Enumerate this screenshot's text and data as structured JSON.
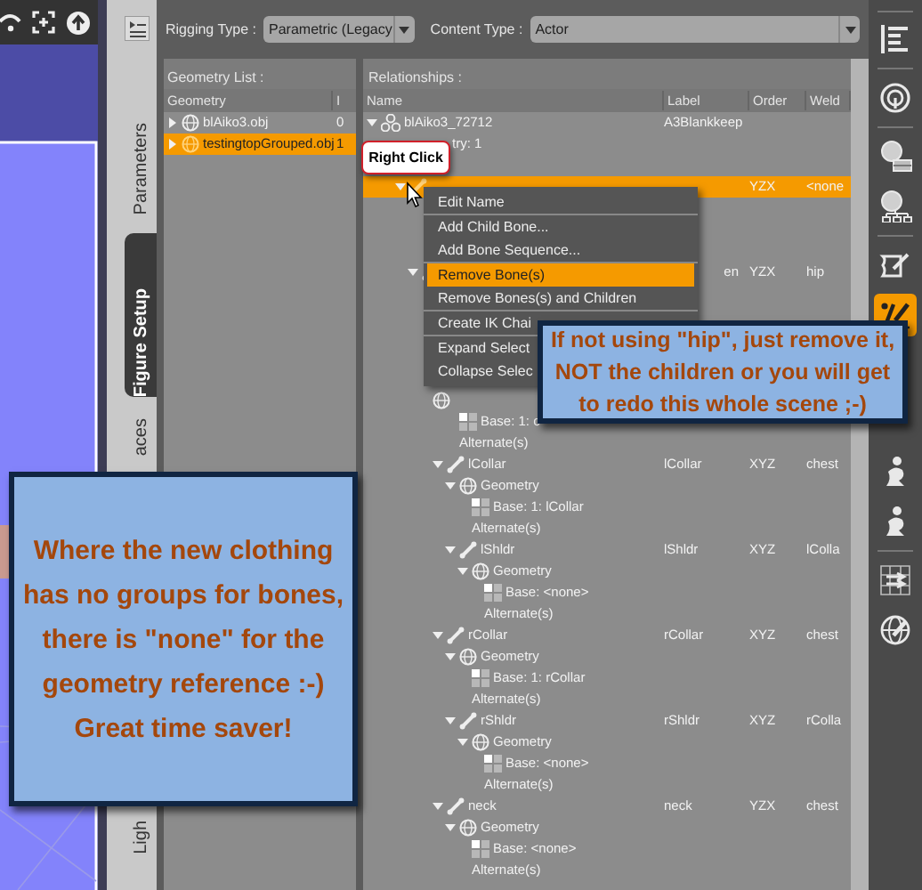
{
  "side_tabs": [
    {
      "label": "Parameters",
      "selected": false
    },
    {
      "label": "Figure Setup",
      "selected": true
    },
    {
      "label": "aces",
      "selected": false
    },
    {
      "label": "Ligh",
      "selected": false
    }
  ],
  "rigging_type": {
    "label": "Rigging Type :",
    "value": "Parametric (Legacy"
  },
  "content_type": {
    "label": "Content Type :",
    "value": "Actor"
  },
  "geometry_list": {
    "title": "Geometry List :",
    "columns": [
      "Geometry",
      "I"
    ],
    "rows": [
      {
        "name": "blAiko3.obj",
        "column_2": "0",
        "selected": false,
        "expanded": false
      },
      {
        "name": "testingtopGrouped.obj",
        "column_2": "1",
        "selected": true,
        "expanded": false
      }
    ]
  },
  "relationships": {
    "title": "Relationships :",
    "columns": [
      "Name",
      "Label",
      "Order",
      "Weld"
    ],
    "tree": [
      {
        "kind": "figure",
        "name": "blAiko3_72712",
        "label": "A3Blankkeep",
        "expanded": true,
        "selected": false,
        "children": [
          {
            "kind": "geometry_count",
            "text": "try: 1"
          },
          {
            "kind": "bone",
            "order": "YZX",
            "weld": "<none",
            "expanded": true,
            "selected": true,
            "children": [
              {
                "kind": "bone",
                "label": "en",
                "order": "YZX",
                "weld": "hip",
                "expanded": true,
                "selected": false,
                "children": [
                  {
                    "children": [
                      {
                        "kind": "geometry",
                        "children": [
                          {
                            "kind": "base",
                            "text": "Base: 1: c"
                          },
                          {
                            "kind": "alternate",
                            "text": "Alternate(s)"
                          }
                        ]
                      },
                      {
                        "kind": "bone",
                        "name": "lCollar",
                        "label": "lCollar",
                        "order": "XYZ",
                        "weld": "chest",
                        "expanded": true,
                        "selected": false,
                        "children": [
                          {
                            "kind": "geometry",
                            "text": "Geometry",
                            "expanded": true,
                            "children": [
                              {
                                "kind": "base",
                                "text": "Base: 1: lCollar"
                              },
                              {
                                "kind": "alternate",
                                "text": "Alternate(s)"
                              }
                            ]
                          },
                          {
                            "kind": "bone",
                            "name": "lShldr",
                            "label": "lShldr",
                            "order": "XYZ",
                            "weld": "lColla",
                            "expanded": true,
                            "selected": false,
                            "children": [
                              {
                                "kind": "geometry",
                                "text": "Geometry",
                                "expanded": true,
                                "children": [
                                  {
                                    "kind": "base",
                                    "text": "Base: <none>"
                                  },
                                  {
                                    "kind": "alternate",
                                    "text": "Alternate(s)"
                                  }
                                ]
                              }
                            ]
                          }
                        ]
                      },
                      {
                        "kind": "bone",
                        "name": "rCollar",
                        "label": "rCollar",
                        "order": "XYZ",
                        "weld": "chest",
                        "expanded": true,
                        "selected": false,
                        "children": [
                          {
                            "kind": "geometry",
                            "text": "Geometry",
                            "expanded": true,
                            "children": [
                              {
                                "kind": "base",
                                "text": "Base: 1: rCollar"
                              },
                              {
                                "kind": "alternate",
                                "text": "Alternate(s)"
                              }
                            ]
                          },
                          {
                            "kind": "bone",
                            "name": "rShldr",
                            "label": "rShldr",
                            "order": "XYZ",
                            "weld": "rColla",
                            "expanded": true,
                            "selected": false,
                            "children": [
                              {
                                "kind": "geometry",
                                "text": "Geometry",
                                "expanded": true,
                                "children": [
                                  {
                                    "kind": "base",
                                    "text": "Base: <none>"
                                  },
                                  {
                                    "kind": "alternate",
                                    "text": "Alternate(s)"
                                  }
                                ]
                              }
                            ]
                          }
                        ]
                      },
                      {
                        "kind": "bone",
                        "name": "neck",
                        "label": "neck",
                        "order": "YZX",
                        "weld": "chest",
                        "expanded": true,
                        "selected": false,
                        "children": [
                          {
                            "kind": "geometry",
                            "text": "Geometry",
                            "expanded": true,
                            "children": [
                              {
                                "kind": "base",
                                "text": "Base: <none>"
                              },
                              {
                                "kind": "alternate",
                                "text": "Alternate(s)"
                              }
                            ]
                          }
                        ]
                      }
                    ]
                  }
                ]
              }
            ]
          }
        ]
      }
    ]
  },
  "context_menu": {
    "sections": [
      [
        {
          "label": "Edit Name",
          "selected": false
        }
      ],
      [
        {
          "label": "Add Child Bone...",
          "selected": false
        },
        {
          "label": "Add Bone Sequence...",
          "selected": false
        }
      ],
      [
        {
          "label": "Remove Bone(s)",
          "selected": true
        },
        {
          "label": "Remove Bones(s) and Children",
          "selected": false
        }
      ],
      [
        {
          "label": "Create IK Chai",
          "selected": false
        }
      ],
      [
        {
          "label": "Expand Select",
          "selected": false
        },
        {
          "label": "Collapse Selec",
          "selected": false
        }
      ]
    ]
  },
  "right_click_bubble": {
    "text": "Right Click"
  },
  "notes": [
    {
      "text": "If not using \"hip\", just remove it, NOT the children or you will get to redo this whole scene ;-)"
    },
    {
      "text": "Where the new clothing has no groups for bones, there is \"none\" for the geometry reference :-) Great time saver!"
    }
  ],
  "sidebar_icons": [
    {
      "kind": "panes",
      "selected": false
    },
    {
      "kind": "dial",
      "selected": false
    },
    {
      "kind": "figure",
      "selected": false
    },
    {
      "kind": "hierarchy",
      "selected": false
    },
    {
      "kind": "script",
      "selected": false
    },
    {
      "kind": "bone_edit",
      "selected": true
    },
    {
      "kind": "pose",
      "selected": false
    },
    {
      "kind": "pose",
      "selected": false
    },
    {
      "kind": "grid",
      "selected": false
    },
    {
      "kind": "globe",
      "selected": false
    }
  ]
}
